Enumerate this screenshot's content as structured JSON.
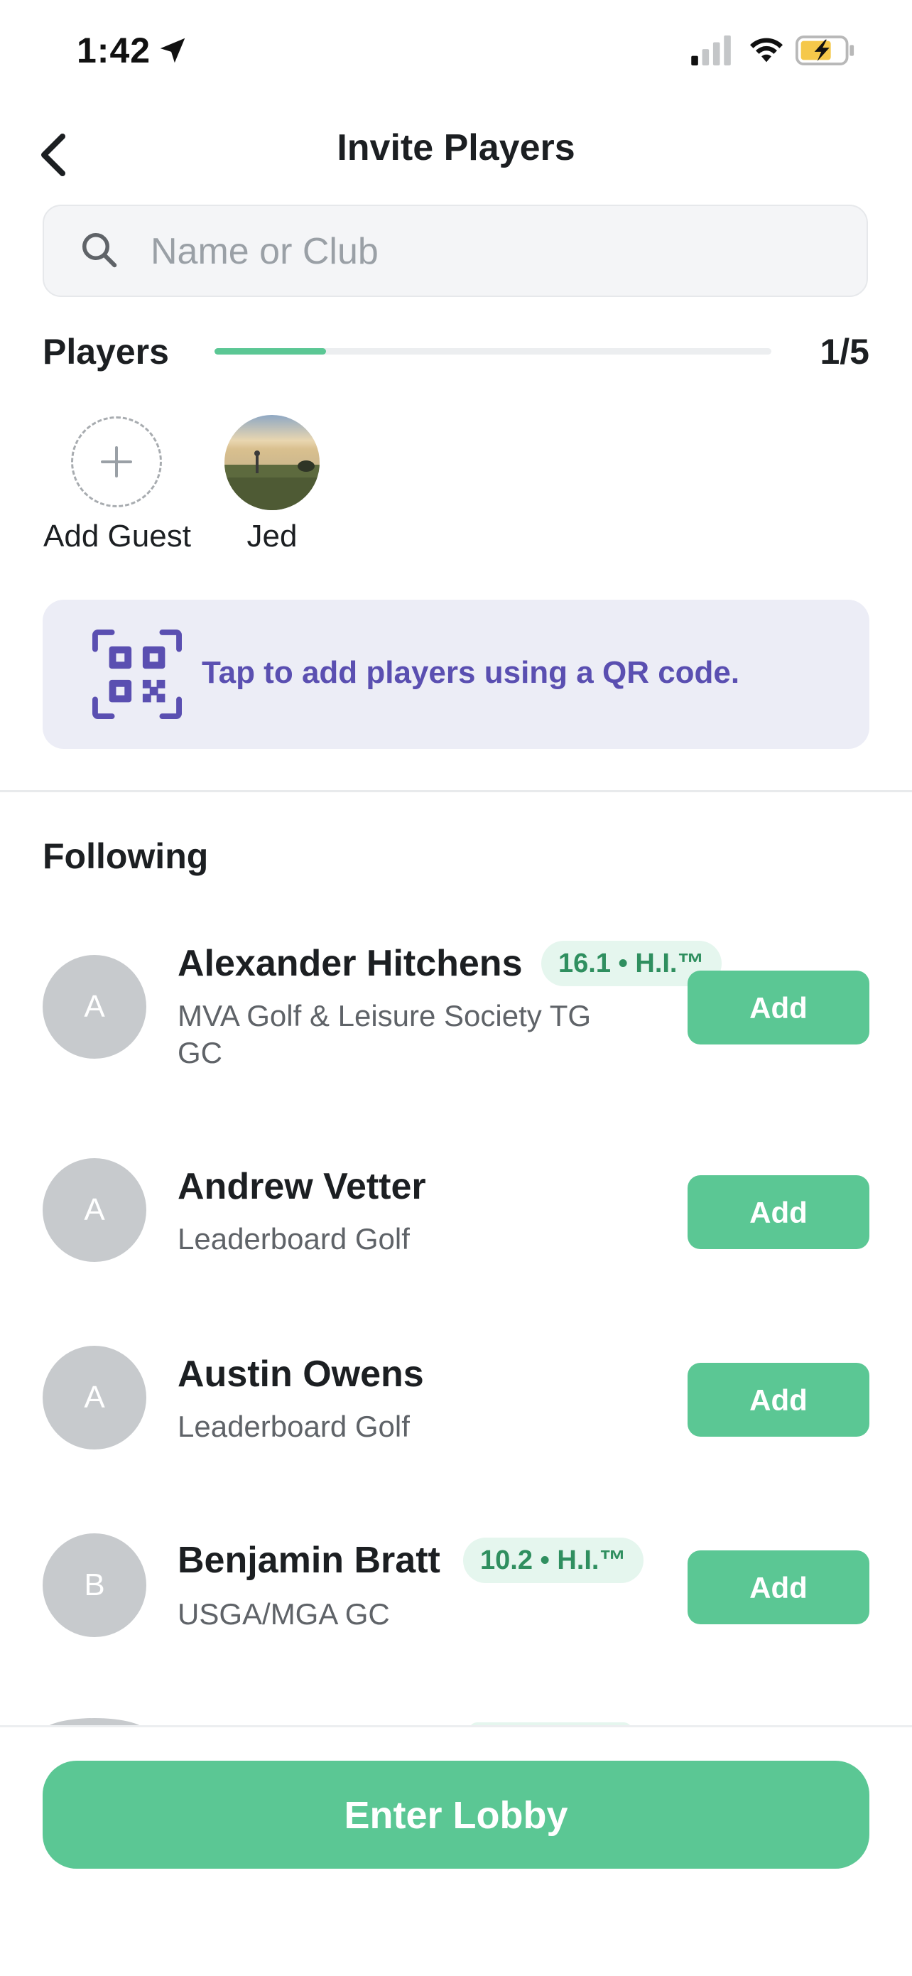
{
  "status_bar": {
    "time": "1:42"
  },
  "header": {
    "title": "Invite Players",
    "back_icon": "chevron-left-icon"
  },
  "search": {
    "placeholder": "Name or Club",
    "value": ""
  },
  "players": {
    "label": "Players",
    "count": "1/5",
    "progress": 0.2,
    "add_guest_label": "Add Guest",
    "selected": [
      {
        "name": "Jed"
      }
    ]
  },
  "qr_banner": {
    "text": "Tap to add players using a QR code.",
    "icon": "qr-code-icon"
  },
  "following": {
    "title": "Following",
    "add_label": "Add",
    "items": [
      {
        "initial": "A",
        "name": "Alexander Hitchens",
        "badge": "16.1 • H.I.™",
        "club_line1": "MVA Golf & Leisure Society TG",
        "club_line2": "GC"
      },
      {
        "initial": "A",
        "name": "Andrew Vetter",
        "badge": "",
        "club_line1": "Leaderboard Golf",
        "club_line2": ""
      },
      {
        "initial": "A",
        "name": "Austin Owens",
        "badge": "",
        "club_line1": "Leaderboard Golf",
        "club_line2": ""
      },
      {
        "initial": "B",
        "name": "Benjamin Bratt",
        "badge": "10.2 • H.I.™",
        "club_line1": "USGA/MGA GC",
        "club_line2": ""
      }
    ]
  },
  "footer": {
    "enter_lobby_label": "Enter Lobby"
  },
  "colors": {
    "accent_green": "#5bc794",
    "qr_purple": "#5a4fb1",
    "badge_bg": "#e5f6ee",
    "badge_text": "#2f8f5f"
  }
}
